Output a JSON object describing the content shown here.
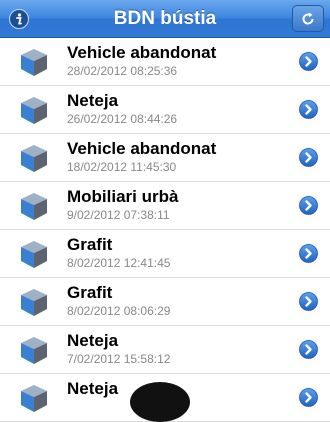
{
  "header": {
    "title": "BDN bústia",
    "info_icon": "info-icon",
    "refresh_icon": "refresh-icon"
  },
  "colors": {
    "nav_bar": "#3d86e0",
    "disclosure": "#2f74d6",
    "date_text": "#888888"
  },
  "items": [
    {
      "title": "Vehicle abandonat",
      "date": "28/02/2012 08:25:36"
    },
    {
      "title": "Neteja",
      "date": "26/02/2012 08:44:26"
    },
    {
      "title": "Vehicle abandonat",
      "date": "18/02/2012 11:45:30"
    },
    {
      "title": "Mobiliari urbà",
      "date": "9/02/2012 07:38:11"
    },
    {
      "title": "Grafit",
      "date": "8/02/2012 12:41:45"
    },
    {
      "title": "Grafit",
      "date": "8/02/2012 08:06:29"
    },
    {
      "title": "Neteja",
      "date": "7/02/2012 15:58:12"
    },
    {
      "title": "Neteja",
      "date": ""
    }
  ]
}
